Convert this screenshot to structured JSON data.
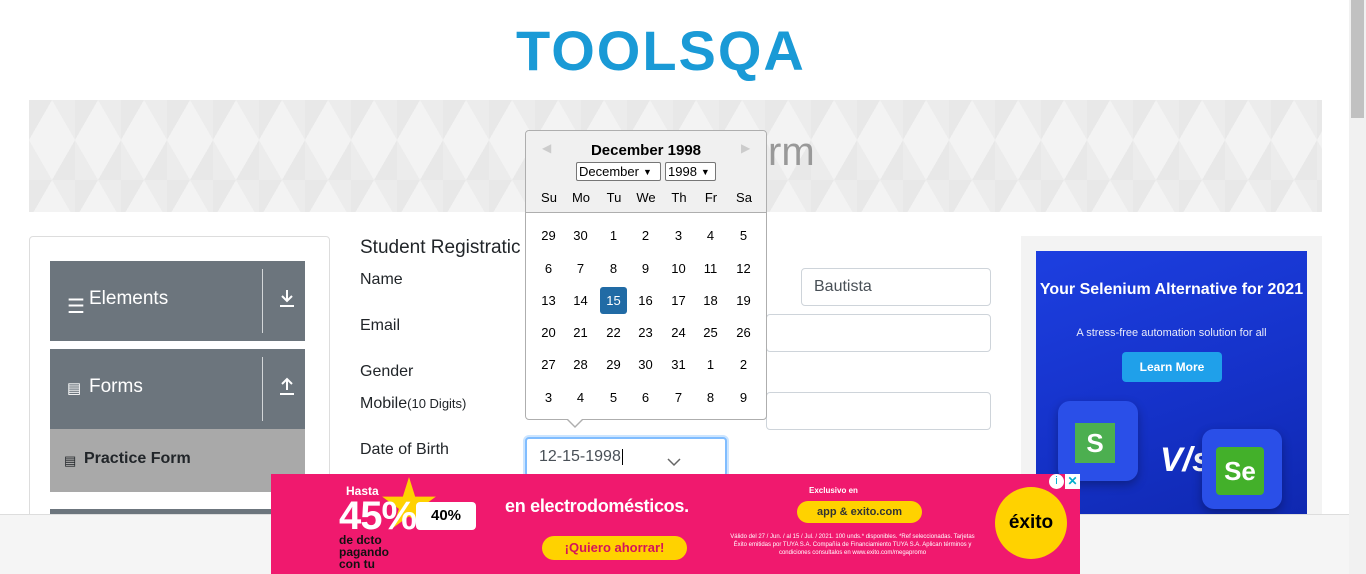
{
  "header": {
    "logo_text": "TOOLSQA"
  },
  "banner": {
    "title_visible": "rm"
  },
  "sidebar": {
    "groups": [
      {
        "label": "Elements",
        "icon": "hamburger-icon",
        "arrow": "download-icon"
      },
      {
        "label": "Forms",
        "icon": "document-icon",
        "arrow": "upload-icon"
      }
    ],
    "active_item": "Practice Form"
  },
  "form": {
    "heading": "Student Registratic",
    "name_label": "Name",
    "last_name_value": "Bautista",
    "email_label": "Email",
    "gender_label": "Gender",
    "mobile_label": "Mobile",
    "mobile_hint": "(10 Digits)",
    "dob_label": "Date of Birth",
    "dob_value": "12-15-1998"
  },
  "datepicker": {
    "title": "December 1998",
    "month_select": "December",
    "year_select": "1998",
    "weekdays": [
      "Su",
      "Mo",
      "Tu",
      "We",
      "Th",
      "Fr",
      "Sa"
    ],
    "weeks": [
      [
        "29",
        "30",
        "1",
        "2",
        "3",
        "4",
        "5"
      ],
      [
        "6",
        "7",
        "8",
        "9",
        "10",
        "11",
        "12"
      ],
      [
        "13",
        "14",
        "15",
        "16",
        "17",
        "18",
        "19"
      ],
      [
        "20",
        "21",
        "22",
        "23",
        "24",
        "25",
        "26"
      ],
      [
        "27",
        "28",
        "29",
        "30",
        "31",
        "1",
        "2"
      ],
      [
        "3",
        "4",
        "5",
        "6",
        "7",
        "8",
        "9"
      ]
    ],
    "selected_day": "15",
    "selected_color": "#216ba5"
  },
  "right_ad": {
    "headline": "Your Selenium Alternative for 2021",
    "subline": "A stress-free automation solution for all",
    "button": "Learn More",
    "vs": "V/s",
    "logo_right": "Se"
  },
  "bottom_ad": {
    "hasta": "Hasta",
    "percent": "45%",
    "extra_percent": "40%",
    "discount_note": "de dcto pagando con tu",
    "headline": "en electrodomésticos.",
    "cta": "¡Quiero ahorrar!",
    "exclusive": "Exclusivo en",
    "app_text": "app & exito.com",
    "fine_print": "Válido del 27 / Jun. / al 15 / Jul. / 2021. 100 unds.* disponibles. *Ref seleccionadas. Tarjetas Éxito emitidas por TUYA S.A. Compañía de Financiamiento TUYA S.A. Aplican términos y condiciones consultalos en www.exito.com/megapromo",
    "brand": "éxito",
    "brand_color": "#f0196e"
  }
}
